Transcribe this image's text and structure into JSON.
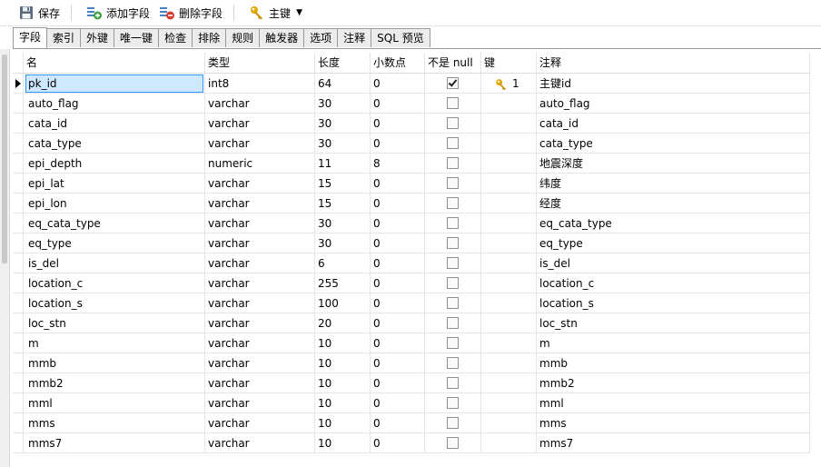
{
  "toolbar": {
    "save_label": "保存",
    "add_field_label": "添加字段",
    "delete_field_label": "删除字段",
    "primary_key_label": "主键"
  },
  "tabs": [
    "字段",
    "索引",
    "外键",
    "唯一键",
    "检查",
    "排除",
    "规则",
    "触发器",
    "选项",
    "注释",
    "SQL 预览"
  ],
  "active_tab": "字段",
  "columns": {
    "name": "名",
    "type": "类型",
    "length": "长度",
    "decimals": "小数点",
    "not_null": "不是 null",
    "key": "键",
    "comment": "注释"
  },
  "rows": [
    {
      "name": "pk_id",
      "type": "int8",
      "length": "64",
      "decimals": "0",
      "not_null": true,
      "key": "1",
      "comment": "主键id"
    },
    {
      "name": "auto_flag",
      "type": "varchar",
      "length": "30",
      "decimals": "0",
      "not_null": false,
      "key": "",
      "comment": "auto_flag"
    },
    {
      "name": "cata_id",
      "type": "varchar",
      "length": "30",
      "decimals": "0",
      "not_null": false,
      "key": "",
      "comment": "cata_id"
    },
    {
      "name": "cata_type",
      "type": "varchar",
      "length": "30",
      "decimals": "0",
      "not_null": false,
      "key": "",
      "comment": "cata_type"
    },
    {
      "name": "epi_depth",
      "type": "numeric",
      "length": "11",
      "decimals": "8",
      "not_null": false,
      "key": "",
      "comment": "地震深度"
    },
    {
      "name": "epi_lat",
      "type": "varchar",
      "length": "15",
      "decimals": "0",
      "not_null": false,
      "key": "",
      "comment": "纬度"
    },
    {
      "name": "epi_lon",
      "type": "varchar",
      "length": "15",
      "decimals": "0",
      "not_null": false,
      "key": "",
      "comment": "经度"
    },
    {
      "name": "eq_cata_type",
      "type": "varchar",
      "length": "30",
      "decimals": "0",
      "not_null": false,
      "key": "",
      "comment": "eq_cata_type"
    },
    {
      "name": "eq_type",
      "type": "varchar",
      "length": "30",
      "decimals": "0",
      "not_null": false,
      "key": "",
      "comment": "eq_type"
    },
    {
      "name": "is_del",
      "type": "varchar",
      "length": "6",
      "decimals": "0",
      "not_null": false,
      "key": "",
      "comment": "is_del"
    },
    {
      "name": "location_c",
      "type": "varchar",
      "length": "255",
      "decimals": "0",
      "not_null": false,
      "key": "",
      "comment": "location_c"
    },
    {
      "name": "location_s",
      "type": "varchar",
      "length": "100",
      "decimals": "0",
      "not_null": false,
      "key": "",
      "comment": "location_s"
    },
    {
      "name": "loc_stn",
      "type": "varchar",
      "length": "20",
      "decimals": "0",
      "not_null": false,
      "key": "",
      "comment": "loc_stn"
    },
    {
      "name": "m",
      "type": "varchar",
      "length": "10",
      "decimals": "0",
      "not_null": false,
      "key": "",
      "comment": "m"
    },
    {
      "name": "mmb",
      "type": "varchar",
      "length": "10",
      "decimals": "0",
      "not_null": false,
      "key": "",
      "comment": "mmb"
    },
    {
      "name": "mmb2",
      "type": "varchar",
      "length": "10",
      "decimals": "0",
      "not_null": false,
      "key": "",
      "comment": "mmb2"
    },
    {
      "name": "mml",
      "type": "varchar",
      "length": "10",
      "decimals": "0",
      "not_null": false,
      "key": "",
      "comment": "mml"
    },
    {
      "name": "mms",
      "type": "varchar",
      "length": "10",
      "decimals": "0",
      "not_null": false,
      "key": "",
      "comment": "mms"
    },
    {
      "name": "mms7",
      "type": "varchar",
      "length": "10",
      "decimals": "0",
      "not_null": false,
      "key": "",
      "comment": "mms7"
    }
  ],
  "selected_row": 0,
  "icons": {
    "save": "floppy-disk-icon",
    "add_field": "add-field-icon",
    "delete_field": "delete-field-icon",
    "primary_key": "key-icon"
  },
  "colors": {
    "selection_fill": "#cde8ff",
    "selection_border": "#3399ff",
    "key_gold": "#e0a800",
    "add_green": "#3aa13a",
    "delete_red": "#d83b2f"
  }
}
